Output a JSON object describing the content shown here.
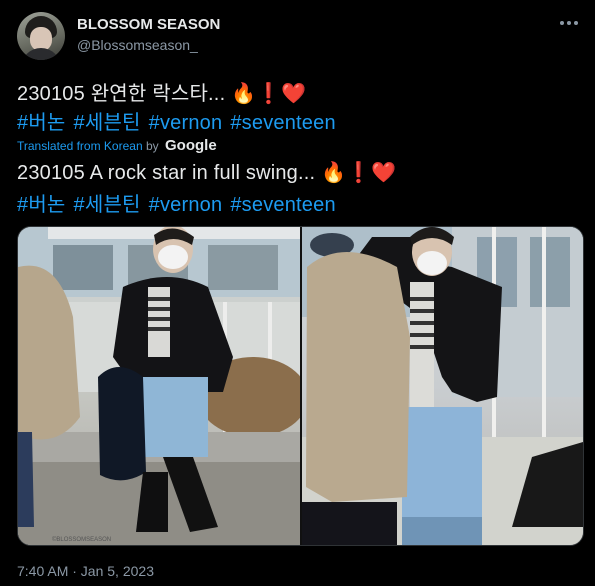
{
  "author": {
    "name": "BLOSSOM SEASON",
    "handle": "@Blossomseason_"
  },
  "tweet": {
    "original_text": "230105 완연한 락스타...",
    "original_emoji": "🔥❗❤️",
    "original_hashtags": [
      "#버논",
      "#세븐틴",
      "#vernon",
      "#seventeen"
    ],
    "translated_label": "Translated from Korean",
    "translated_by": "by",
    "translator": "Google",
    "translated_text": "230105 A rock star in full swing...",
    "translated_emoji": "🔥❗❤️",
    "translated_hashtags": [
      "#버논",
      "#세븐틴",
      "#vernon",
      "#seventeen"
    ]
  },
  "media": {
    "photo_watermark": "©BLOSSOMSEASON"
  },
  "footer": {
    "timestamp": "7:40 AM · Jan 5, 2023"
  },
  "colors": {
    "background": "#000000",
    "text": "#e7e9ea",
    "secondary": "#8b98a5",
    "link": "#1d9bf0",
    "fire": "#ff8a1f",
    "heart": "#e0245e"
  },
  "icons": {
    "more": "more-horizontal-icon",
    "fire": "fire-icon",
    "exclamation": "exclamation-icon",
    "heart": "heart-icon"
  }
}
